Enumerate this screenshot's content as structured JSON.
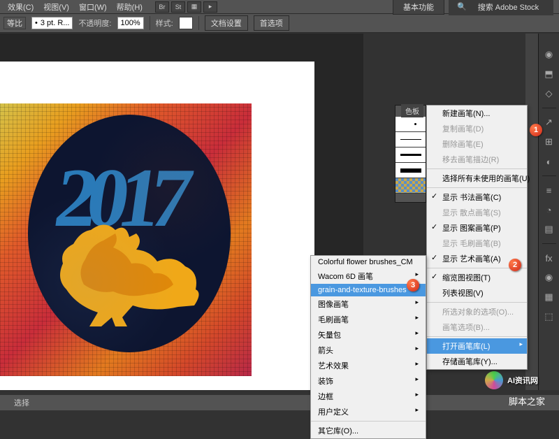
{
  "menubar": {
    "items": [
      "效果(C)",
      "视图(V)",
      "窗口(W)",
      "帮助(H)"
    ],
    "icons": [
      "Br",
      "St",
      "▦",
      "▸"
    ],
    "workspace": "基本功能",
    "search_placeholder": "搜索 Adobe Stock"
  },
  "toolbar": {
    "stroke_label": "等比",
    "stroke_value": "3 pt. R...",
    "opacity_label": "不透明度:",
    "opacity_value": "100%",
    "style_label": "样式:",
    "btn1": "文档设置",
    "btn2": "首选项"
  },
  "brush_panel": {
    "tab": "色板"
  },
  "flyout_menu": {
    "items": [
      {
        "label": "新建画笔(N)...",
        "enabled": true
      },
      {
        "label": "复制画笔(D)",
        "enabled": false
      },
      {
        "label": "删除画笔(E)",
        "enabled": false
      },
      {
        "label": "移去画笔描边(R)",
        "enabled": false,
        "sep": true
      },
      {
        "label": "选择所有未使用的画笔(U)",
        "enabled": true,
        "sep": true
      },
      {
        "label": "显示 书法画笔(C)",
        "enabled": true,
        "checked": true
      },
      {
        "label": "显示 散点画笔(S)",
        "enabled": false
      },
      {
        "label": "显示 图案画笔(P)",
        "enabled": true,
        "checked": true
      },
      {
        "label": "显示 毛刷画笔(B)",
        "enabled": false
      },
      {
        "label": "显示 艺术画笔(A)",
        "enabled": true,
        "checked": true,
        "sep": true
      },
      {
        "label": "缩览图视图(T)",
        "enabled": true,
        "checked": true
      },
      {
        "label": "列表视图(V)",
        "enabled": true,
        "sep": true
      },
      {
        "label": "所选对象的选项(O)...",
        "enabled": false
      },
      {
        "label": "画笔选项(B)...",
        "enabled": false,
        "sep": true
      },
      {
        "label": "打开画笔库(L)",
        "enabled": true,
        "hi": true,
        "sub": true
      },
      {
        "label": "存储画笔库(Y)...",
        "enabled": true
      }
    ]
  },
  "submenu": {
    "items": [
      {
        "label": "Colorful flower brushes_CM"
      },
      {
        "label": "Wacom 6D 画笔",
        "sub": true
      },
      {
        "label": "grain-and-texture-brushes",
        "hi": true
      },
      {
        "label": "图像画笔",
        "sub": true
      },
      {
        "label": "毛刷画笔",
        "sub": true
      },
      {
        "label": "矢量包",
        "sub": true
      },
      {
        "label": "箭头",
        "sub": true
      },
      {
        "label": "艺术效果",
        "sub": true
      },
      {
        "label": "装饰",
        "sub": true
      },
      {
        "label": "边框",
        "sub": true
      },
      {
        "label": "用户定义",
        "sub": true,
        "sep": true
      },
      {
        "label": "其它库(O)..."
      }
    ]
  },
  "right_icons": [
    "◉",
    "⬒",
    "◇",
    "↗",
    "⊞",
    "◐",
    "≡",
    "◔",
    "▤",
    "fx",
    "◉",
    "▦",
    "⬚"
  ],
  "callouts": {
    "c1": "1",
    "c2": "2",
    "c3": "3"
  },
  "statusbar": {
    "tool": "选择"
  },
  "watermark": {
    "text": "AI资讯网"
  },
  "footer": "脚本之家",
  "artwork": {
    "year": "2017"
  }
}
